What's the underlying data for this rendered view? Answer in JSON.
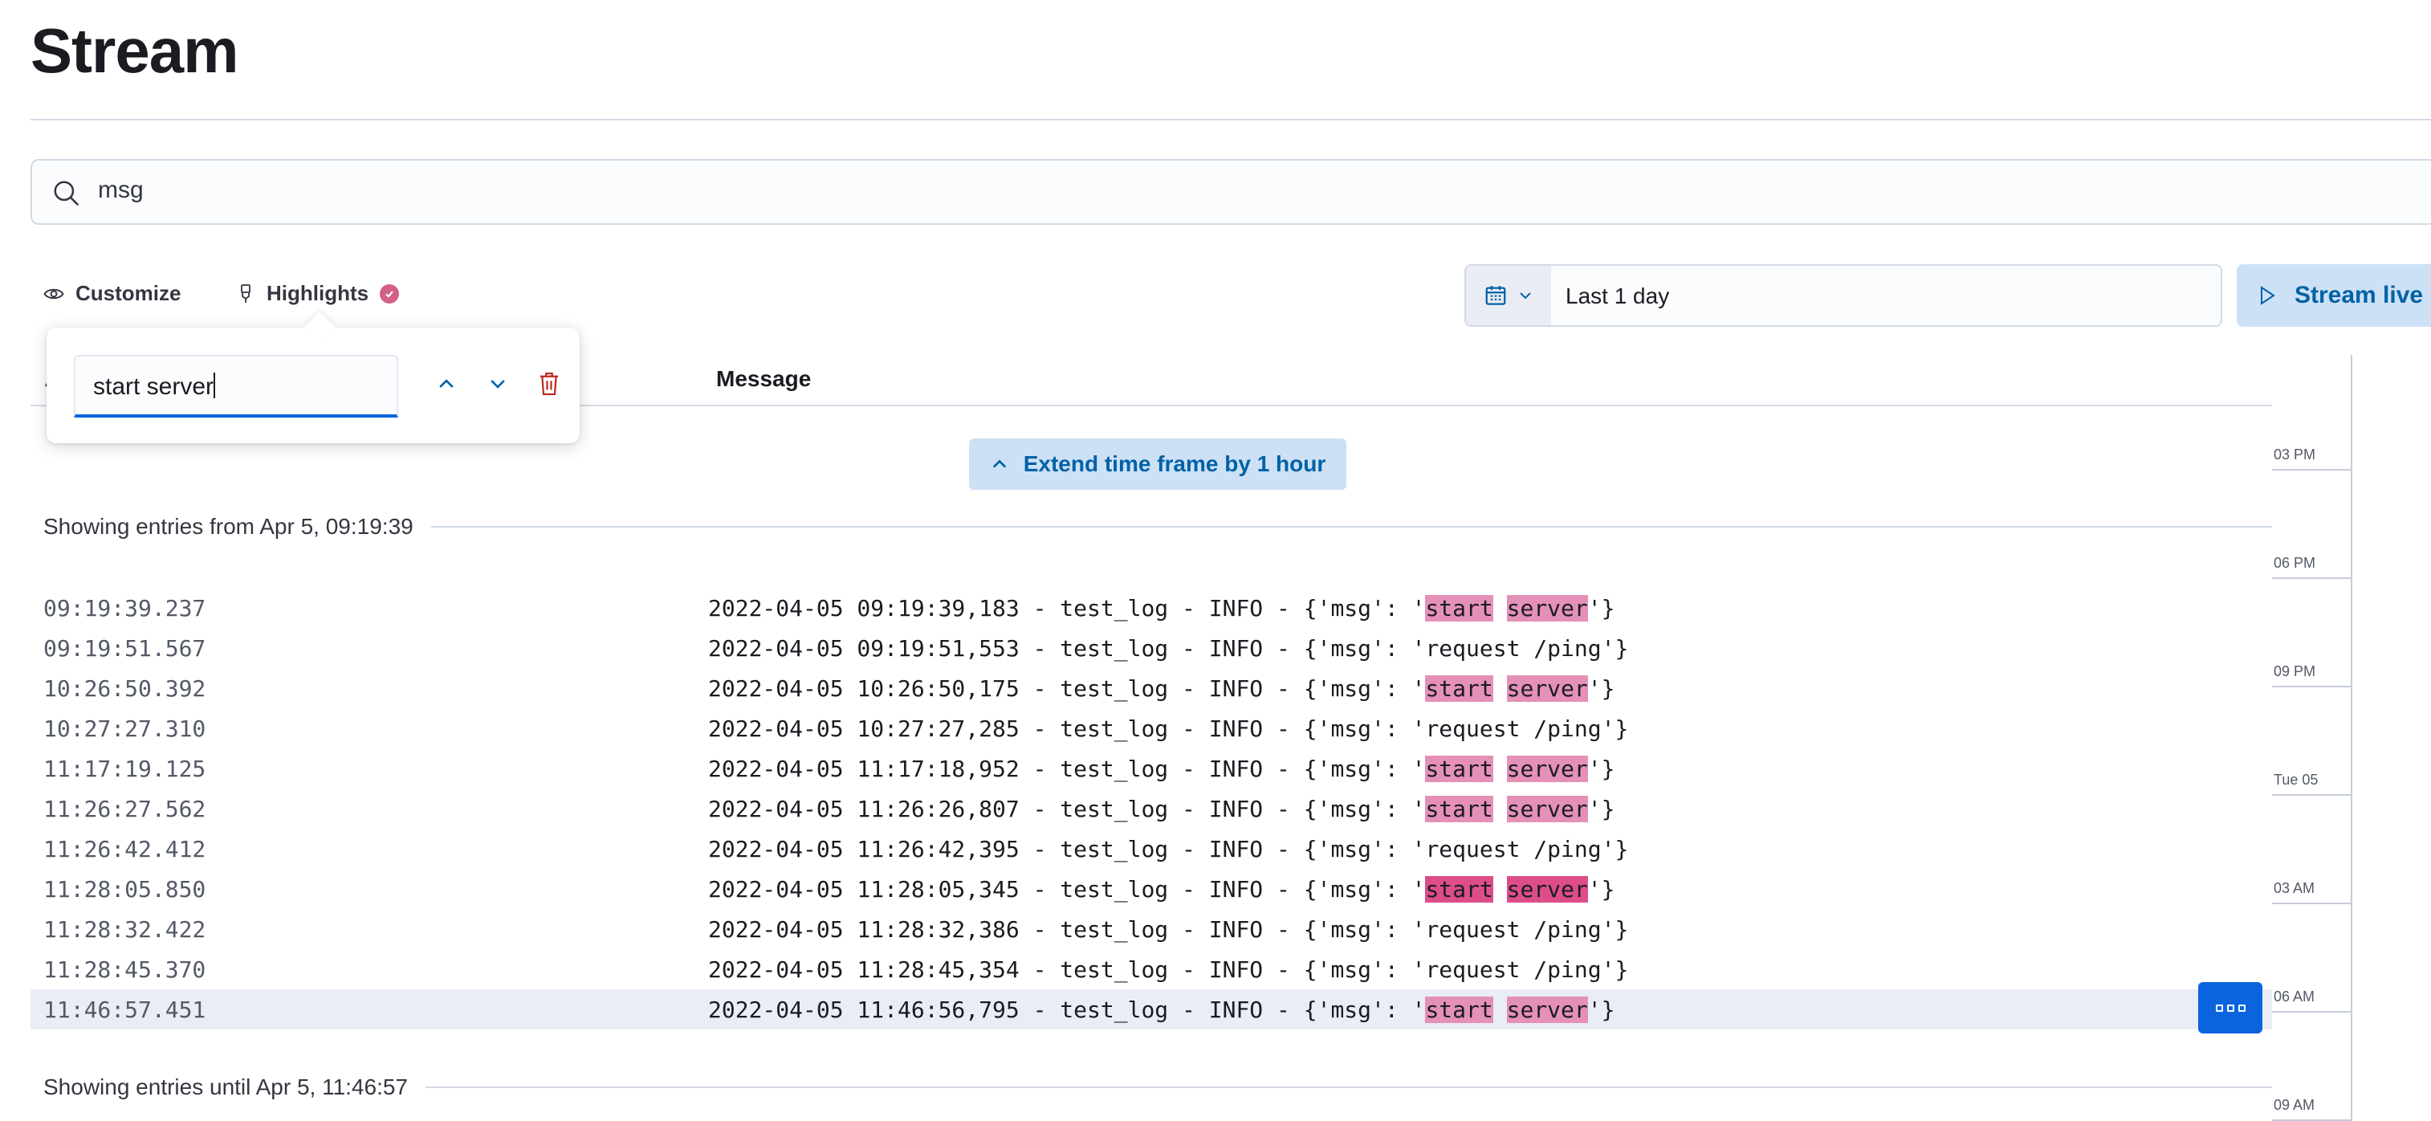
{
  "page": {
    "title": "Stream"
  },
  "search": {
    "value": "msg",
    "icon": "search-icon"
  },
  "toolbar": {
    "customize_label": "Customize",
    "highlights_label": "Highlights"
  },
  "date_picker": {
    "range": "Last 1 day",
    "icon": "calendar-icon"
  },
  "stream_live": {
    "label": "Stream live"
  },
  "highlight_popover": {
    "term": "start server"
  },
  "columns": {
    "message": "Message",
    "timestamp_partial": "A"
  },
  "extend": {
    "label": "Extend time frame by 1 hour"
  },
  "range_start": "Showing entries from Apr 5, 09:19:39",
  "range_end": "Showing entries until Apr 5, 11:46:57",
  "logs": [
    {
      "ts": "09:19:39.237",
      "pre": "2022-04-05 09:19:39,183 - test_log - INFO - {'msg': '",
      "h1": "start",
      "h2": "server",
      "post": "'}"
    },
    {
      "ts": "09:19:51.567",
      "pre": "2022-04-05 09:19:51,553 - test_log - INFO - {'msg': 'request /ping'}"
    },
    {
      "ts": "10:26:50.392",
      "pre": "2022-04-05 10:26:50,175 - test_log - INFO - {'msg': '",
      "h1": "start",
      "h2": "server",
      "post": "'}"
    },
    {
      "ts": "10:27:27.310",
      "pre": "2022-04-05 10:27:27,285 - test_log - INFO - {'msg': 'request /ping'}"
    },
    {
      "ts": "11:17:19.125",
      "pre": "2022-04-05 11:17:18,952 - test_log - INFO - {'msg': '",
      "h1": "start",
      "h2": "server",
      "post": "'}"
    },
    {
      "ts": "11:26:27.562",
      "pre": "2022-04-05 11:26:26,807 - test_log - INFO - {'msg': '",
      "h1": "start",
      "h2": "server",
      "post": "'}"
    },
    {
      "ts": "11:26:42.412",
      "pre": "2022-04-05 11:26:42,395 - test_log - INFO - {'msg': 'request /ping'}"
    },
    {
      "ts": "11:28:05.850",
      "pre": "2022-04-05 11:28:05,345 - test_log - INFO - {'msg': '",
      "h1": "start",
      "h2": "server",
      "post": "'}",
      "active": true
    },
    {
      "ts": "11:28:32.422",
      "pre": "2022-04-05 11:28:32,386 - test_log - INFO - {'msg': 'request /ping'}"
    },
    {
      "ts": "11:28:45.370",
      "pre": "2022-04-05 11:28:45,354 - test_log - INFO - {'msg': 'request /ping'}"
    },
    {
      "ts": "11:46:57.451",
      "pre": "2022-04-05 11:46:56,795 - test_log - INFO - {'msg': '",
      "h1": "start",
      "h2": "server",
      "post": "'}",
      "selected": true
    }
  ],
  "minimap_ticks": [
    "03 PM",
    "06 PM",
    "09 PM",
    "Tue 05",
    "03 AM",
    "06 AM",
    "09 AM"
  ],
  "colors": {
    "accent": "#0061a6",
    "highlight": "#e590b8",
    "highlight_active": "#dc4d8a",
    "badge": "#d36086"
  }
}
